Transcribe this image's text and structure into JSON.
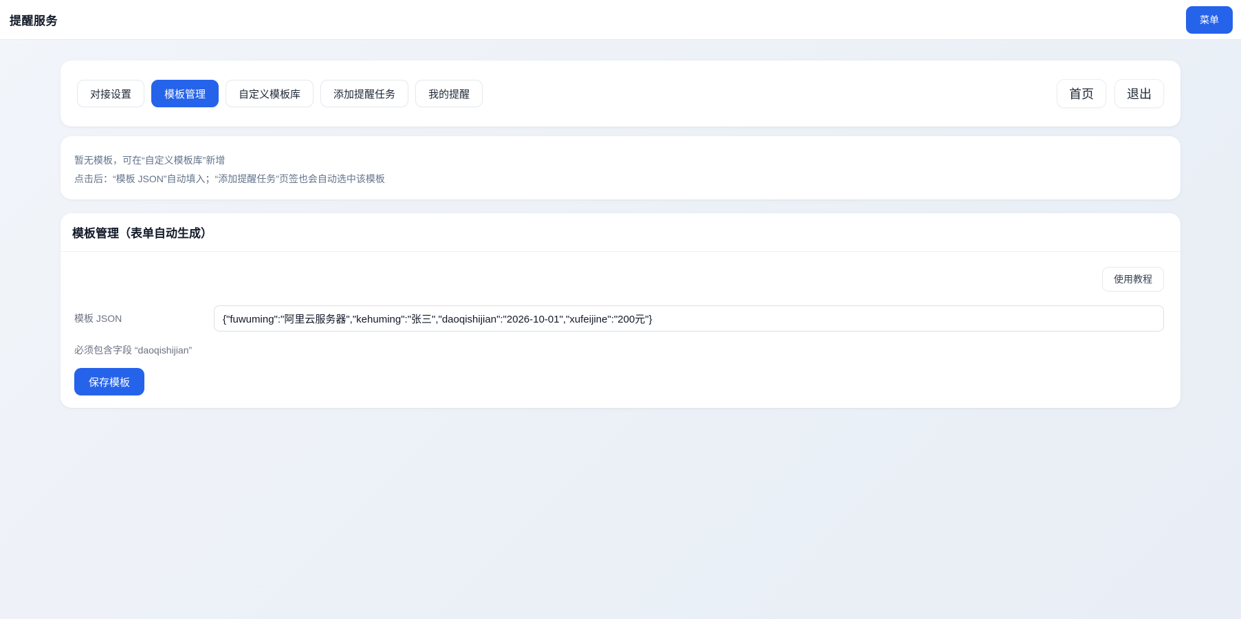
{
  "header": {
    "title": "提醒服务",
    "menu_button": "菜单"
  },
  "nav": {
    "tabs": [
      {
        "label": "对接设置",
        "active": false
      },
      {
        "label": "模板管理",
        "active": true
      },
      {
        "label": "自定义模板库",
        "active": false
      },
      {
        "label": "添加提醒任务",
        "active": false
      },
      {
        "label": "我的提醒",
        "active": false
      }
    ],
    "actions": [
      {
        "label": "首页"
      },
      {
        "label": "退出"
      }
    ]
  },
  "notice": {
    "line1": "暂无模板，可在“自定义模板库”新增",
    "line2": "点击后：“模板 JSON”自动填入；“添加提醒任务”页签也会自动选中该模板"
  },
  "template_section": {
    "title": "模板管理（表单自动生成）",
    "tutorial_button": "使用教程",
    "json_label": "模板 JSON",
    "json_value": "{\"fuwuming\":\"阿里云服务器\",\"kehuming\":\"张三\",\"daoqishijian\":\"2026-10-01\",\"xufeijine\":\"200元\"}",
    "helper_text": "必须包含字段 “daoqishijian”",
    "save_button": "保存模板"
  },
  "colors": {
    "accent_blue": "#2563eb",
    "page_background": "#edf1f7",
    "muted_text": "#64748b"
  }
}
